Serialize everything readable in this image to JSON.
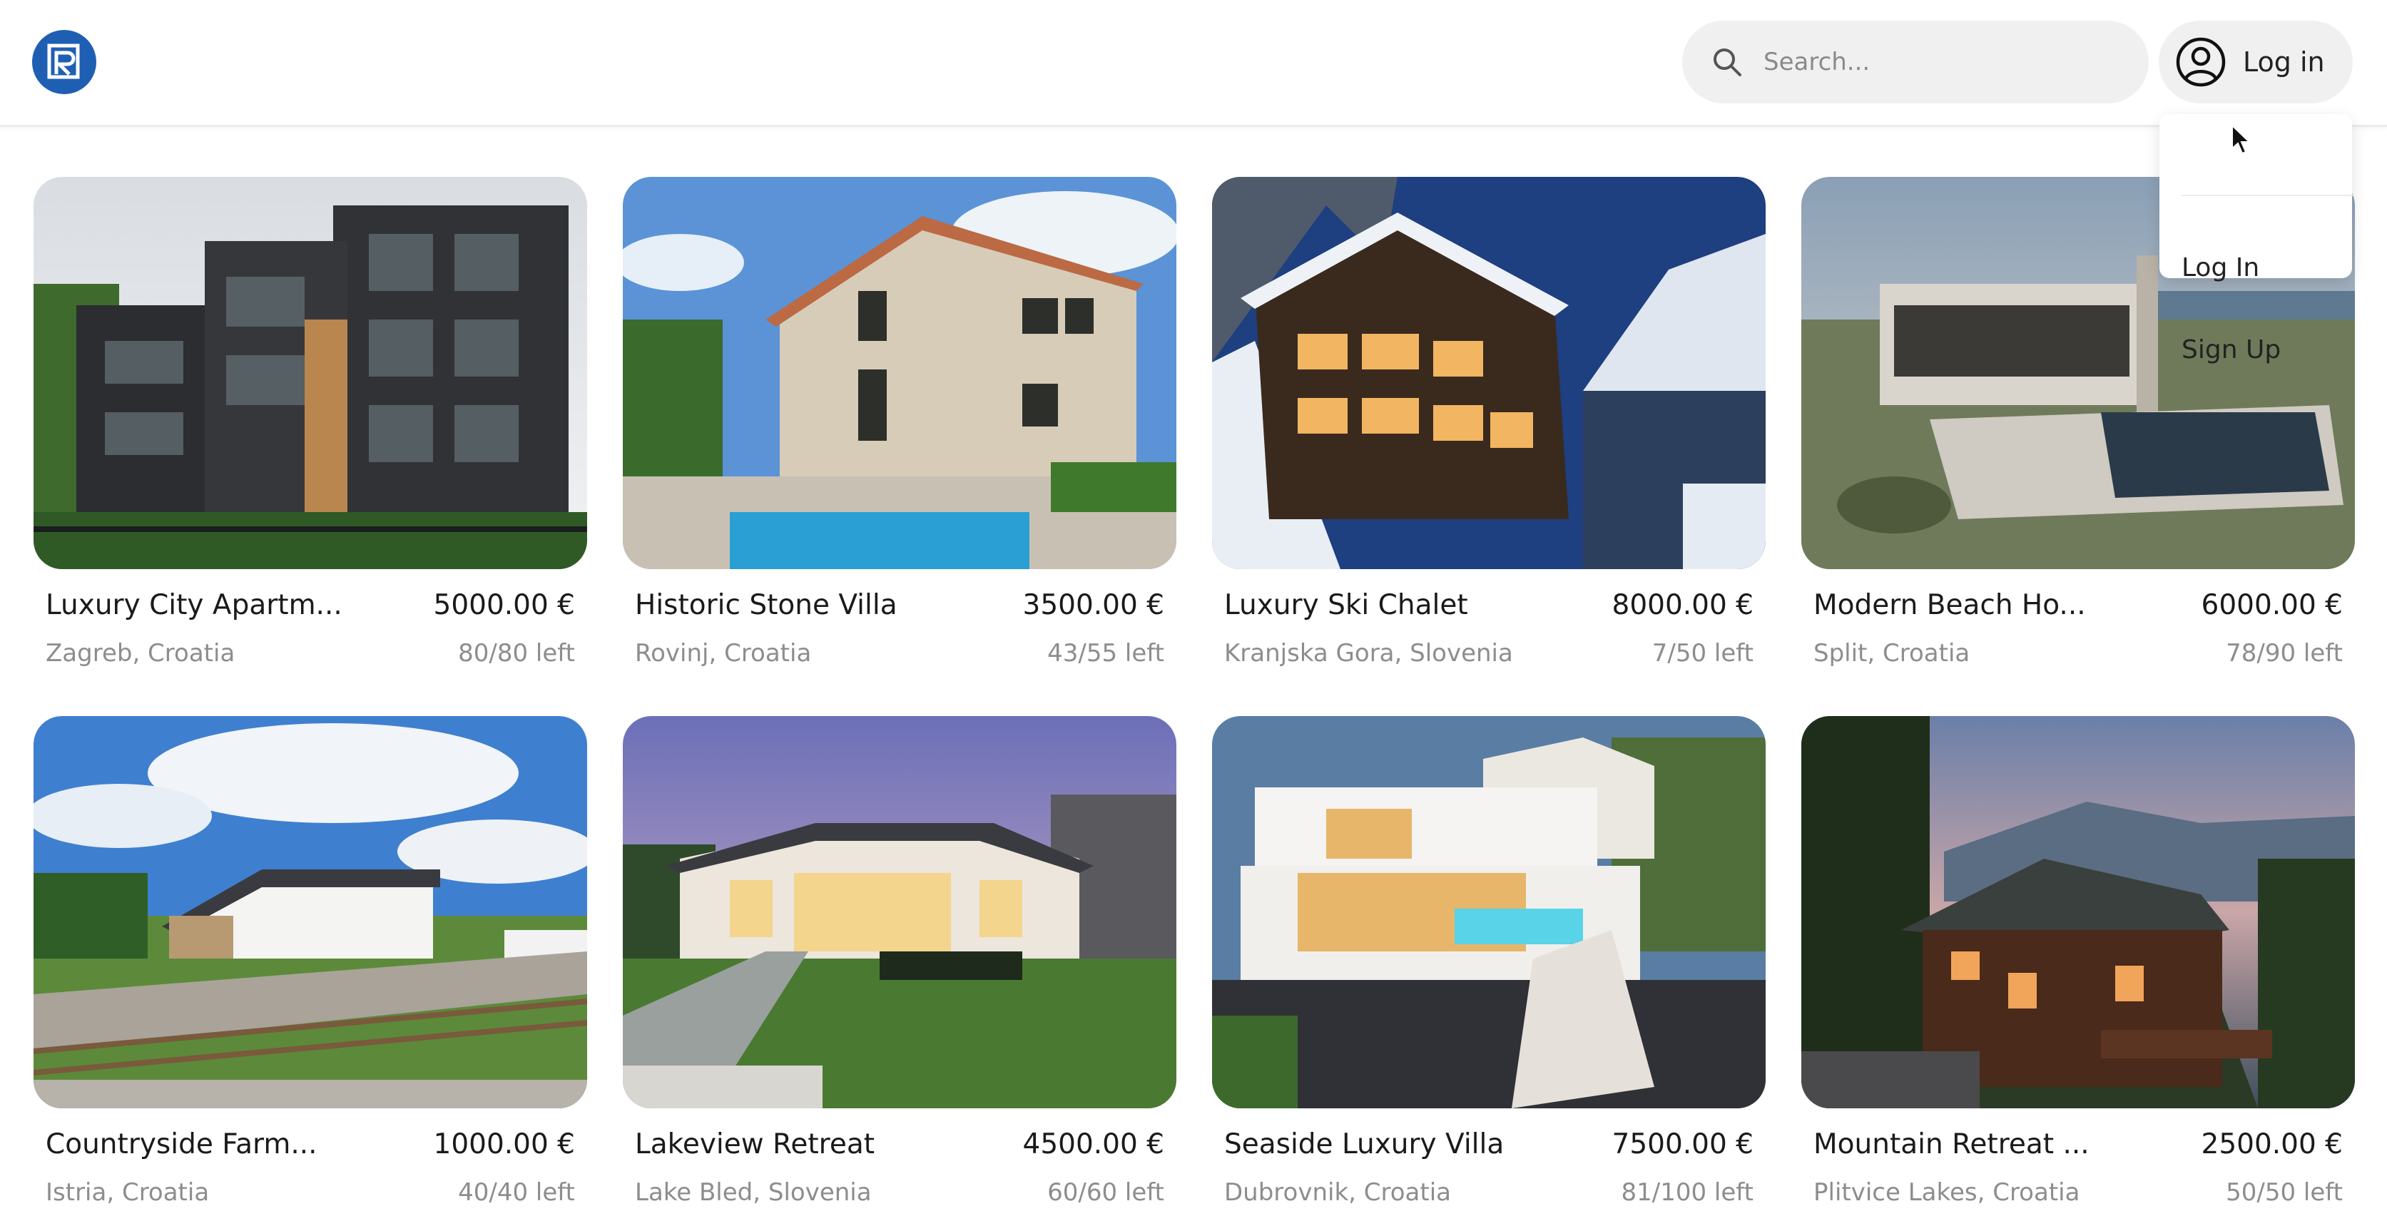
{
  "header": {
    "search": {
      "placeholder": "Search..."
    },
    "login_label": "Log in"
  },
  "dropdown": {
    "items": [
      "Log In",
      "Sign Up"
    ]
  },
  "listings": [
    {
      "title": "Luxury City Apartm...",
      "price": "5000.00 €",
      "location": "Zagreb, Croatia",
      "availability": "80/80 left",
      "scene": "city-apartment"
    },
    {
      "title": "Historic Stone Villa",
      "price": "3500.00 €",
      "location": "Rovinj, Croatia",
      "availability": "43/55 left",
      "scene": "stone-villa"
    },
    {
      "title": "Luxury Ski Chalet",
      "price": "8000.00 €",
      "location": "Kranjska Gora, Slovenia",
      "availability": "7/50 left",
      "scene": "ski-chalet"
    },
    {
      "title": "Modern Beach Ho...",
      "price": "6000.00 €",
      "location": "Split, Croatia",
      "availability": "78/90 left",
      "scene": "beach-house"
    },
    {
      "title": "Countryside Farm...",
      "price": "1000.00 €",
      "location": "Istria, Croatia",
      "availability": "40/40 left",
      "scene": "farmhouse"
    },
    {
      "title": "Lakeview Retreat",
      "price": "4500.00 €",
      "location": "Lake Bled, Slovenia",
      "availability": "60/60 left",
      "scene": "lakeview"
    },
    {
      "title": "Seaside Luxury Villa",
      "price": "7500.00 €",
      "location": "Dubrovnik, Croatia",
      "availability": "81/100 left",
      "scene": "seaside-villa"
    },
    {
      "title": "Mountain Retreat ...",
      "price": "2500.00 €",
      "location": "Plitvice Lakes, Croatia",
      "availability": "50/50 left",
      "scene": "mountain-cabin"
    }
  ],
  "colors": {
    "brand": "#1f5fb3",
    "pill_bg": "#f0f0f0",
    "muted_text": "#8d8d8d"
  }
}
